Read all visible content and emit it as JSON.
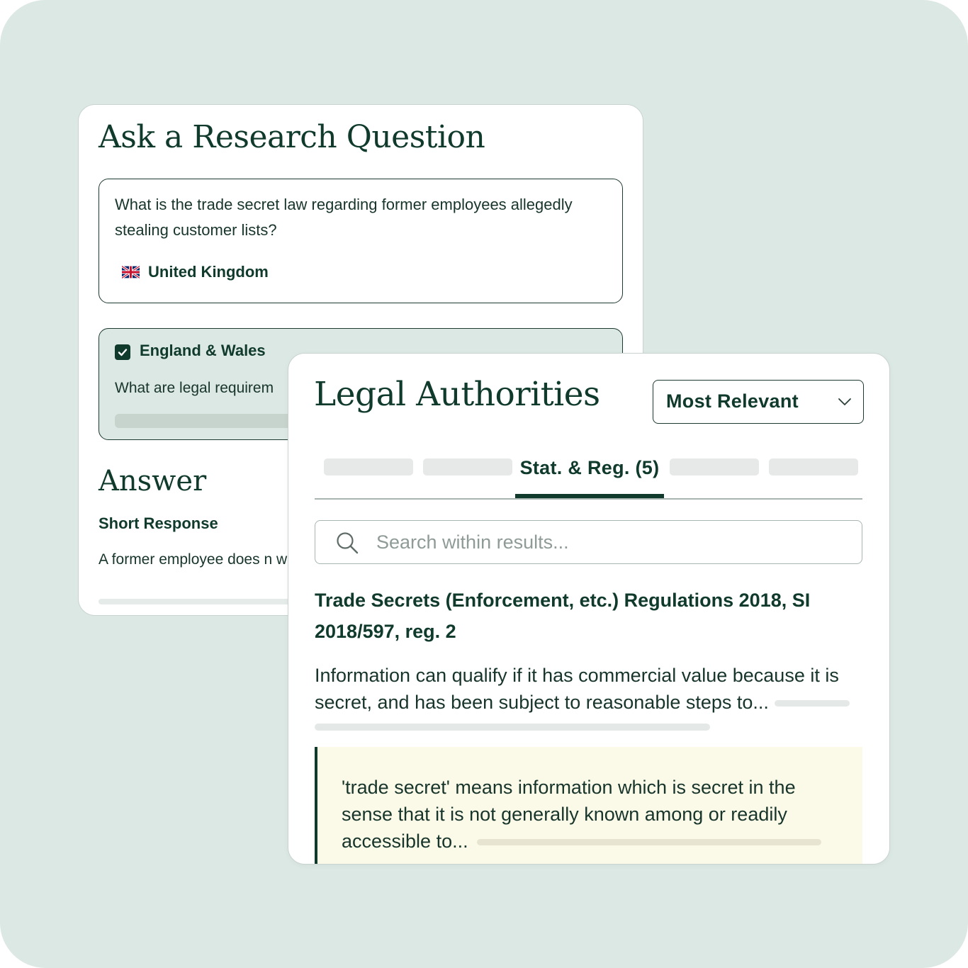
{
  "research": {
    "title": "Ask a Research Question",
    "question": "What is the trade secret law regarding former employees allegedly stealing customer lists?",
    "jurisdiction": "United Kingdom",
    "jurisdiction_icon": "uk-flag-icon",
    "sub_jurisdiction": {
      "label": "England & Wales",
      "checked": true,
      "question": "What are legal requirem"
    },
    "answer_heading": "Answer",
    "short_response_heading": "Short Response",
    "short_response_text": "A former employee does n who the customers are or l"
  },
  "authorities": {
    "title": "Legal Authorities",
    "sort": {
      "selected": "Most Relevant"
    },
    "tabs": {
      "active_label": "Stat. & Reg. (5)"
    },
    "search": {
      "placeholder": "Search within results..."
    },
    "result": {
      "title": "Trade Secrets (Enforcement, etc.) Regulations 2018, SI 2018/597, reg. 2",
      "description": "Information can qualify if it has commercial value because it is secret, and has been subject to reasonable steps to...",
      "quote": "'trade secret' means information which is secret in the sense that it is not generally known among or readily accessible to..."
    }
  },
  "colors": {
    "background": "#dce8e3",
    "ink": "#0f3a2c",
    "quote_bg": "#fbf9e8"
  }
}
